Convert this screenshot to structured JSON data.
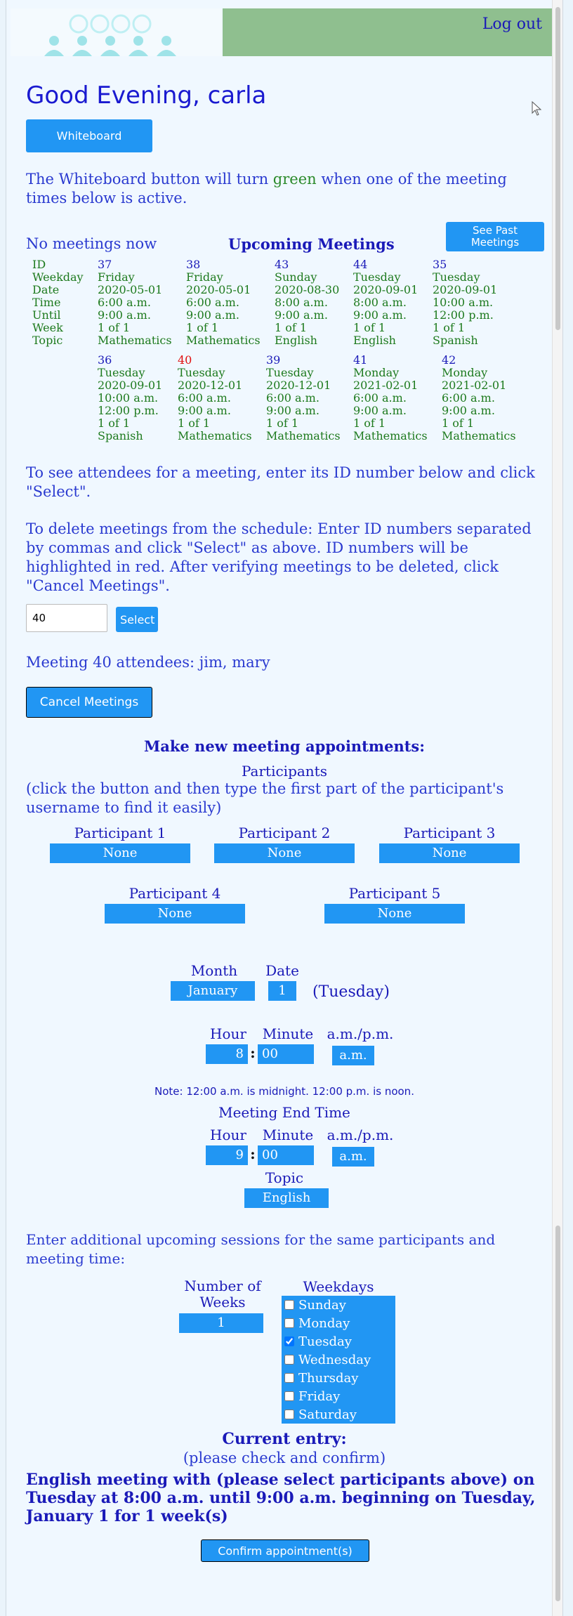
{
  "header": {
    "logout": "Log out"
  },
  "greeting": "Good Evening, carla",
  "whiteboard_button": "Whiteboard",
  "whiteboard_note": {
    "before": "The Whiteboard button will turn ",
    "green_word": "green",
    "after": " when one of the meeting times below is active."
  },
  "no_meetings": "No meetings now",
  "upcoming_title": "Upcoming Meetings",
  "see_past_button": "See Past Meetings",
  "row_labels": [
    "ID",
    "Weekday",
    "Date",
    "Time",
    "Until",
    "Week",
    "Topic"
  ],
  "meetings_row1": [
    {
      "id": "37",
      "weekday": "Friday",
      "date": "2020-05-01",
      "time": "6:00 a.m.",
      "until": "9:00 a.m.",
      "week": "1 of 1",
      "topic": "Mathematics",
      "highlight": false
    },
    {
      "id": "38",
      "weekday": "Friday",
      "date": "2020-05-01",
      "time": "6:00 a.m.",
      "until": "9:00 a.m.",
      "week": "1 of 1",
      "topic": "Mathematics",
      "highlight": false
    },
    {
      "id": "43",
      "weekday": "Sunday",
      "date": "2020-08-30",
      "time": "8:00 a.m.",
      "until": "9:00 a.m.",
      "week": "1 of 1",
      "topic": "English",
      "highlight": false
    },
    {
      "id": "44",
      "weekday": "Tuesday",
      "date": "2020-09-01",
      "time": "8:00 a.m.",
      "until": "9:00 a.m.",
      "week": "1 of 1",
      "topic": "English",
      "highlight": false
    },
    {
      "id": "35",
      "weekday": "Tuesday",
      "date": "2020-09-01",
      "time": "10:00 a.m.",
      "until": "12:00 p.m.",
      "week": "1 of 1",
      "topic": "Spanish",
      "highlight": false
    }
  ],
  "meetings_row2": [
    {
      "id": "36",
      "weekday": "Tuesday",
      "date": "2020-09-01",
      "time": "10:00 a.m.",
      "until": "12:00 p.m.",
      "week": "1 of 1",
      "topic": "Spanish",
      "highlight": false
    },
    {
      "id": "40",
      "weekday": "Tuesday",
      "date": "2020-12-01",
      "time": "6:00 a.m.",
      "until": "9:00 a.m.",
      "week": "1 of 1",
      "topic": "Mathematics",
      "highlight": true
    },
    {
      "id": "39",
      "weekday": "Tuesday",
      "date": "2020-12-01",
      "time": "6:00 a.m.",
      "until": "9:00 a.m.",
      "week": "1 of 1",
      "topic": "Mathematics",
      "highlight": false
    },
    {
      "id": "41",
      "weekday": "Monday",
      "date": "2021-02-01",
      "time": "6:00 a.m.",
      "until": "9:00 a.m.",
      "week": "1 of 1",
      "topic": "Mathematics",
      "highlight": false
    },
    {
      "id": "42",
      "weekday": "Monday",
      "date": "2021-02-01",
      "time": "6:00 a.m.",
      "until": "9:00 a.m.",
      "week": "1 of 1",
      "topic": "Mathematics",
      "highlight": false
    }
  ],
  "attendee_instructions": "To see attendees for a meeting, enter its ID number below and click \"Select\".",
  "delete_instructions": "To delete meetings from the schedule: Enter ID numbers separated by commas and click \"Select\" as above. ID numbers will be highlighted in red. After verifying meetings to be deleted, click \"Cancel Meetings\".",
  "id_input_value": "40",
  "select_button": "Select",
  "attendees_text": "Meeting 40 attendees: jim, mary",
  "cancel_button": "Cancel Meetings",
  "new_title": "Make new meeting appointments:",
  "participants_title": "Participants",
  "participants_hint": "(click the button and then type the first part of the participant's username to find it easily)",
  "participants": [
    {
      "label": "Participant 1",
      "value": "None"
    },
    {
      "label": "Participant 2",
      "value": "None"
    },
    {
      "label": "Participant 3",
      "value": "None"
    },
    {
      "label": "Participant 4",
      "value": "None"
    },
    {
      "label": "Participant 5",
      "value": "None"
    }
  ],
  "month_label": "Month",
  "date_label": "Date",
  "month_value": "January",
  "date_value": "1",
  "weekday_display": "(Tuesday)",
  "hour_label": "Hour",
  "minute_label": "Minute",
  "ampm_label": "a.m./p.m.",
  "start_hour": "8",
  "start_minute": "00",
  "start_ampm": "a.m.",
  "note": "Note: 12:00 a.m. is midnight. 12:00 p.m. is noon.",
  "end_title": "Meeting End Time",
  "end_hour": "9",
  "end_minute": "00",
  "end_ampm": "a.m.",
  "topic_label": "Topic",
  "topic_value": "English",
  "additional_text": "Enter additional upcoming sessions for the same participants and meeting time:",
  "weeks_label": "Number of Weeks",
  "weeks_value": "1",
  "weekdays_label": "Weekdays",
  "weekdays": [
    {
      "name": "Sunday",
      "checked": false
    },
    {
      "name": "Monday",
      "checked": false
    },
    {
      "name": "Tuesday",
      "checked": true
    },
    {
      "name": "Wednesday",
      "checked": false
    },
    {
      "name": "Thursday",
      "checked": false
    },
    {
      "name": "Friday",
      "checked": false
    },
    {
      "name": "Saturday",
      "checked": false
    }
  ],
  "current_entry_title": "Current entry:",
  "current_entry_sub": "(please check and confirm)",
  "current_entry_text": "English meeting with (please select participants above) on Tuesday at 8:00 a.m. until 9:00 a.m. beginning on Tuesday, January 1 for 1 week(s)",
  "confirm_button": "Confirm appointment(s)"
}
